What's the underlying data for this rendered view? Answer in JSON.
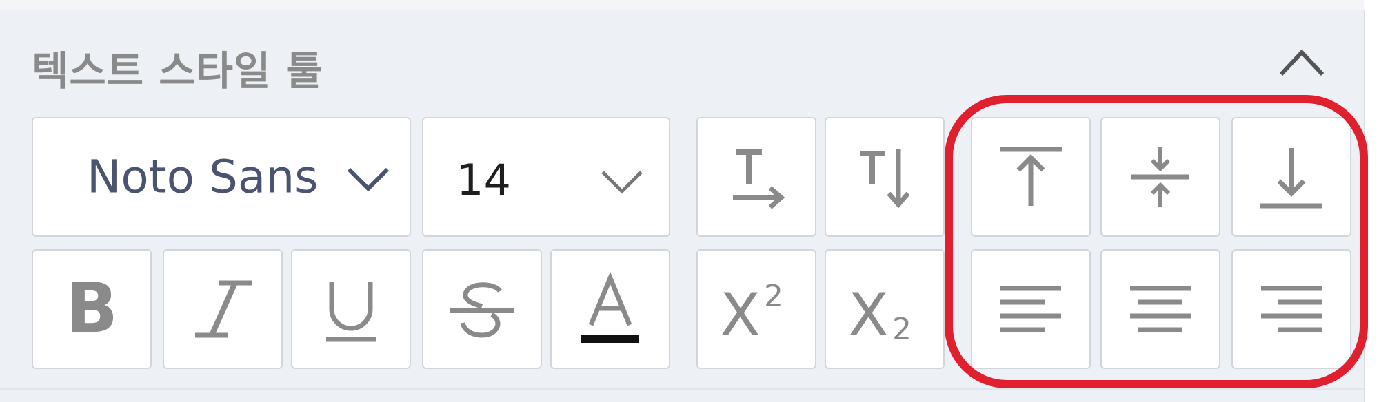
{
  "panel": {
    "title": "텍스트 스타일 툴",
    "collapse_icon": "chevron-up-icon"
  },
  "font": {
    "value": "Noto Sans",
    "icon": "chevron-down-icon"
  },
  "font_size": {
    "value": "14",
    "icon": "chevron-down-icon"
  },
  "toolbar_row1": [
    {
      "name": "text-direction-horizontal",
      "icon": "horizontal-text-icon"
    },
    {
      "name": "text-direction-vertical",
      "icon": "vertical-text-icon"
    },
    {
      "name": "align-top",
      "icon": "align-top-icon"
    },
    {
      "name": "align-middle",
      "icon": "align-middle-icon"
    },
    {
      "name": "align-bottom",
      "icon": "align-bottom-icon"
    }
  ],
  "toolbar_row2": [
    {
      "name": "bold",
      "icon": "bold-icon"
    },
    {
      "name": "italic",
      "icon": "italic-icon"
    },
    {
      "name": "underline",
      "icon": "underline-icon"
    },
    {
      "name": "strikethrough",
      "icon": "strikethrough-icon"
    },
    {
      "name": "font-color",
      "icon": "font-color-icon"
    },
    {
      "name": "superscript",
      "icon": "superscript-icon"
    },
    {
      "name": "subscript",
      "icon": "subscript-icon"
    },
    {
      "name": "align-left",
      "icon": "align-left-icon"
    },
    {
      "name": "align-center",
      "icon": "align-center-icon"
    },
    {
      "name": "align-right",
      "icon": "align-right-icon"
    }
  ],
  "colors": {
    "panel_bg": "#edf1f6",
    "icon": "#8a8a8a",
    "font_color_swatch": "#111111",
    "highlight": "#e0202e"
  }
}
